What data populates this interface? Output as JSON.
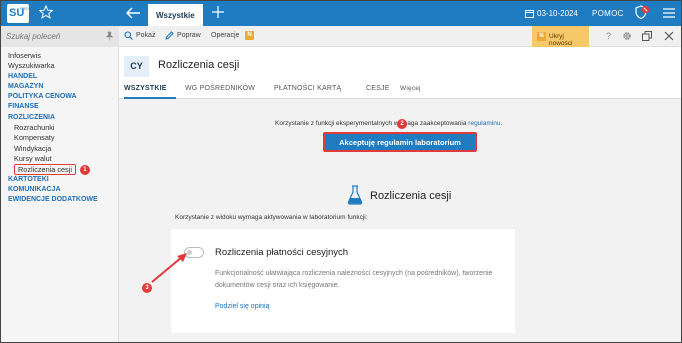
{
  "app": {
    "logo_text": "SU",
    "logo_sub": "PRO",
    "active_tab": "Wszystkie",
    "date": "03-10-2024",
    "help": "POMOC"
  },
  "sidebar": {
    "search_placeholder": "Szukaj poleceń",
    "items": [
      {
        "label": "Infoserwis",
        "type": "plain"
      },
      {
        "label": "Wyszukiwarka",
        "type": "plain"
      },
      {
        "label": "HANDEL",
        "type": "section"
      },
      {
        "label": "MAGAZYN",
        "type": "section"
      },
      {
        "label": "POLITYKA CENOWA",
        "type": "section"
      },
      {
        "label": "FINANSE",
        "type": "section"
      },
      {
        "label": "ROZLICZENIA",
        "type": "section"
      },
      {
        "label": "Rozrachunki",
        "type": "sub"
      },
      {
        "label": "Kompensaty",
        "type": "sub"
      },
      {
        "label": "Windykacja",
        "type": "sub"
      },
      {
        "label": "Kursy walut",
        "type": "sub"
      },
      {
        "label": "Rozliczenia cesji",
        "type": "sub"
      },
      {
        "label": "KARTOTEKI",
        "type": "section"
      },
      {
        "label": "KOMUNIKACJA",
        "type": "section"
      },
      {
        "label": "EWIDENCJE DODATKOWE",
        "type": "section"
      }
    ]
  },
  "toolbar": {
    "show": "Pokaż",
    "fix": "Popraw",
    "operations": "Operacje",
    "n_badge": "N",
    "hide_news": "Ukryj nowości",
    "help_q": "?"
  },
  "page": {
    "code": "CY",
    "title": "Rozliczenia cesji",
    "tabs": [
      "WSZYSTKIE",
      "WG POŚREDNIKÓW",
      "PŁATNOŚCI KARTĄ",
      "CESJE",
      "Więcej"
    ]
  },
  "content": {
    "notice_prefix": "Korzystanie z funkcji eksperymentalnych wymaga zaakceptowania ",
    "notice_link": "regulaminu",
    "notice_suffix": ".",
    "accept_button": "Akceptuję regulamin laboratorium",
    "lab_title": "Rozliczenia cesji",
    "lab_info": "Korzystanie z widoku wymaga aktywowania w laboratorium funkcji:",
    "feature_title": "Rozliczenia płatności cesyjnych",
    "feature_desc": "Funkcjonalność ułatwiająca rozliczenia należności cesyjnych (na pośredników), tworzenie dokumentów cesji oraz ich księgowanie.",
    "feature_link": "Podziel się opinią"
  },
  "annotations": {
    "b1": "1",
    "b2": "2",
    "b3": "3"
  },
  "colors": {
    "brand_blue": "#1f7cc0",
    "annotation_red": "#e03a3a",
    "news_yellow": "#f7c86a"
  }
}
